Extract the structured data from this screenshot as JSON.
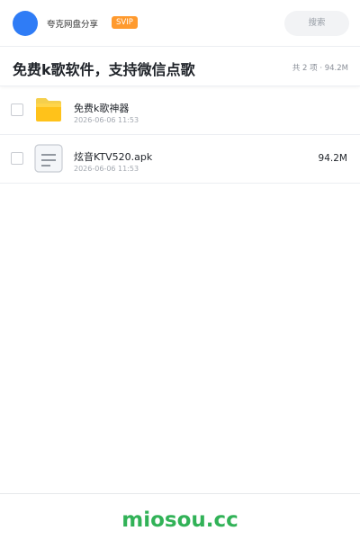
{
  "header": {
    "user_name": "夸克网盘分享",
    "badge": "SVIP",
    "search_placeholder": "搜索"
  },
  "share": {
    "title": "免费k歌软件，支持微信点歌",
    "summary": "共 2 项 · 94.2M"
  },
  "files": [
    {
      "name": "免费k歌神器",
      "date": "2026-06-06 11:53",
      "size": "",
      "icon": "folder-icon"
    },
    {
      "name": "炫音KTV520.apk",
      "date": "2026-06-06 11:53",
      "size": "94.2M",
      "icon": "file-document-icon"
    }
  ],
  "footer": {
    "brand": "miosou.cc"
  },
  "colors": {
    "accent": "#2f7cf6",
    "svip": "#ff9a2e",
    "folder": "#ffc21a",
    "brand": "#31b257"
  }
}
